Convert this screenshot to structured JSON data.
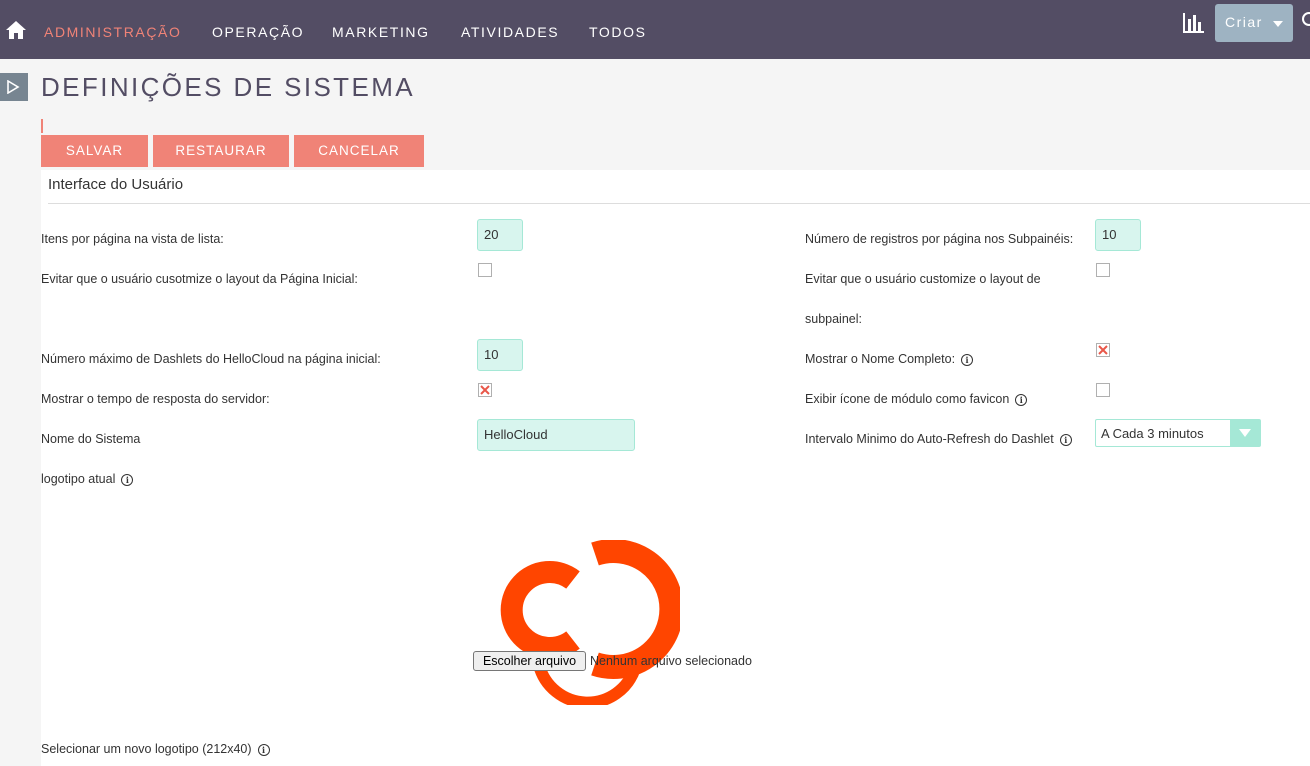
{
  "nav": {
    "items": [
      "ADMINISTRAÇÃO",
      "OPERAÇÃO",
      "MARKETING",
      "ATIVIDADES",
      "TODOS"
    ],
    "active_index": 0,
    "create_label": "Criar",
    "icons": {
      "home": "home-icon",
      "reports": "bar-chart-icon",
      "search": "search-icon"
    }
  },
  "page": {
    "title": "DEFINIÇÕES DE SISTEMA",
    "buttons": {
      "save": "SALVAR",
      "restore": "RESTAURAR",
      "cancel": "CANCELAR"
    }
  },
  "section": {
    "title": "Interface do Usuário",
    "fields": {
      "list_items_label": "Itens por página na vista de lista:",
      "list_items_value": "20",
      "subpanel_items_label": "Número de registros por página nos Subpainéis:",
      "subpanel_items_value": "10",
      "prevent_home_label": "Evitar que o usuário cusotmize o layout da Página Inicial:",
      "prevent_home_checked": false,
      "prevent_subpanel_label_line1": "Evitar que o usuário customize o layout de",
      "prevent_subpanel_label_line2": "subpainel:",
      "prevent_subpanel_checked": false,
      "max_dashlets_label": "Número máximo de Dashlets do HelloCloud na página inicial:",
      "max_dashlets_value": "10",
      "full_name_label": "Mostrar o Nome Completo:",
      "full_name_checked": true,
      "response_time_label": "Mostrar o tempo de resposta do servidor:",
      "response_time_checked": true,
      "favicon_label": "Exibir ícone de módulo como favicon",
      "favicon_checked": false,
      "system_name_label": "Nome do Sistema",
      "system_name_value": "HelloCloud",
      "autorefresh_label": "Intervalo Minimo do Auto-Refresh do Dashlet",
      "autorefresh_value": "A Cada 3 minutos",
      "current_logo_label": "logotipo atual",
      "choose_file_label": "Escolher arquivo",
      "no_file_text": "Nenhum arquivo selecionado",
      "new_logo_label": "Selecionar um novo logotipo (212x40)"
    }
  },
  "colors": {
    "nav_bg": "#534d64",
    "accent": "#f08377",
    "input_bg": "#d8f5ee",
    "logo": "#ff4500",
    "create_btn": "#9eb3c2"
  }
}
